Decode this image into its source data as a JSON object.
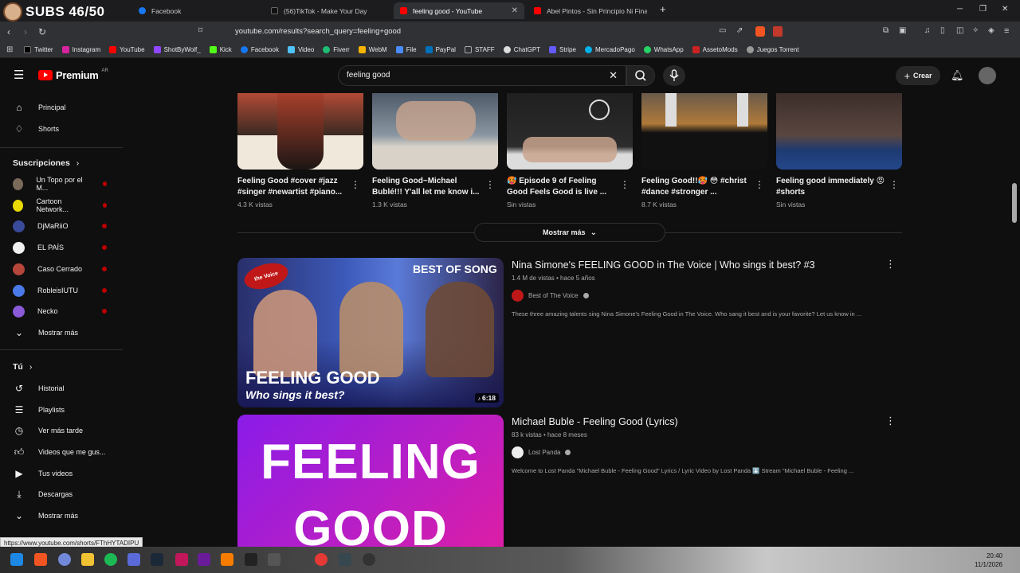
{
  "overlay": {
    "subs": "SUBS 46/50"
  },
  "tabs": [
    {
      "title": "Facebook",
      "color": "#1877f2"
    },
    {
      "title": "(56)TikTok - Make Your Day",
      "color": "#111111"
    },
    {
      "title": "feeling good - YouTube",
      "color": "#ff0000"
    },
    {
      "title": "Abel Pintos - Sin Principio Ni Final (O...",
      "color": "#ff0000"
    }
  ],
  "address": {
    "url": "youtube.com/results?search_query=feeling+good"
  },
  "bookmarks": [
    {
      "label": "Twitter",
      "color": "#000000"
    },
    {
      "label": "Instagram",
      "color": "#d6249f"
    },
    {
      "label": "YouTube",
      "color": "#ff0000"
    },
    {
      "label": "ShotByWolf_",
      "color": "#9146ff"
    },
    {
      "label": "Kick",
      "color": "#53fc18"
    },
    {
      "label": "Facebook",
      "color": "#1877f2"
    },
    {
      "label": "Video",
      "color": "#4fc3f7"
    },
    {
      "label": "Fiverr",
      "color": "#1dbf73"
    },
    {
      "label": "WebM",
      "color": "#f4b400"
    },
    {
      "label": "File",
      "color": "#4a8cff"
    },
    {
      "label": "PayPal",
      "color": "#0070ba"
    },
    {
      "label": "STAFF",
      "color": "#aaaaaa"
    },
    {
      "label": "ChatGPT",
      "color": "#dddddd"
    },
    {
      "label": "Stripe",
      "color": "#635bff"
    },
    {
      "label": "MercadoPago",
      "color": "#00b1ea"
    },
    {
      "label": "WhatsApp",
      "color": "#25d366"
    },
    {
      "label": "AssetoMods",
      "color": "#cc2222"
    },
    {
      "label": "Juegos Torrent",
      "color": "#999999"
    }
  ],
  "youtube": {
    "logo": "Premium",
    "logo_badge": "AR",
    "search_value": "feeling good",
    "create_label": "Crear"
  },
  "sidebar": {
    "main": [
      {
        "label": "Principal",
        "icon": "home-icon"
      },
      {
        "label": "Shorts",
        "icon": "shorts-icon"
      }
    ],
    "subs_header": "Suscripciones",
    "subscriptions": [
      {
        "label": "Un Topo por el M...",
        "color": "#7a6a5a"
      },
      {
        "label": "Cartoon Network...",
        "color": "#e8d900"
      },
      {
        "label": "DjMaRiiO",
        "color": "#3a4a9a"
      },
      {
        "label": "EL PAÍS",
        "color": "#f1f1f1"
      },
      {
        "label": "Caso Cerrado",
        "color": "#b7463a"
      },
      {
        "label": "RobleisIUTU",
        "color": "#4a7ae8"
      },
      {
        "label": "Necko",
        "color": "#8a5ad8"
      }
    ],
    "more_subs": "Mostrar más",
    "you_header": "Tú",
    "you_items": [
      {
        "label": "Historial",
        "icon": "history-icon"
      },
      {
        "label": "Playlists",
        "icon": "playlists-icon"
      },
      {
        "label": "Ver más tarde",
        "icon": "watch-later-icon"
      },
      {
        "label": "Videos que me gus...",
        "icon": "like-icon"
      },
      {
        "label": "Tus videos",
        "icon": "your-videos-icon"
      },
      {
        "label": "Descargas",
        "icon": "downloads-icon"
      }
    ],
    "more_you": "Mostrar más"
  },
  "shorts": [
    {
      "title": "Feeling Good #cover #jazz #singer #newartist #piano...",
      "views": "4.3 K vistas",
      "bg": "#8a3b2a"
    },
    {
      "title": "Feeling Good~Michael Bublé!!! Y'all let me know i...",
      "views": "1.3 K vistas",
      "bg": "#5a6a78"
    },
    {
      "title": "🥵 Episode 9 of Feeling Good Feels Good is live ...",
      "views": "Sin vistas",
      "bg": "#2a2a2a"
    },
    {
      "title": "Feeling Good!!🥵 😳 #christ #dance #stronger ...",
      "views": "8.7 K vistas",
      "bg": "#6a4a2a"
    },
    {
      "title": "Feeling good immediately 😡 #shorts",
      "views": "Sin vistas",
      "bg": "#4a3a3a"
    }
  ],
  "show_more": "Mostrar más",
  "videos": [
    {
      "title": "Nina Simone's FEELING GOOD in The Voice | Who sings it best? #3",
      "meta": "1.4 M de vistas • hace 5 años",
      "channel": "Best of The Voice",
      "desc": "These three amazing talents sing Nina Simone's Feeling Good in The Voice. Who sang it best and is your favorite? Let us know in ...",
      "duration": "6:18",
      "thumb_text1": "FEELING GOOD",
      "thumb_text2": "Who sings it best?",
      "thumb_badge": "BEST OF SONG",
      "thumb_logo": "the Voice"
    },
    {
      "title": "Michael Buble - Feeling Good (Lyrics)",
      "meta": "83 k vistas • hace 8 meses",
      "channel": "Lost Panda",
      "desc": "Welcome to Lost Panda \"Michael Buble - Feeling Good\" Lyrics / Lyric Video by Lost Panda ⬇️ Stream \"Michael Buble - Feeling ...",
      "thumb_line1": "FEELING",
      "thumb_line2": "GOOD"
    }
  ],
  "status_url": "https://www.youtube.com/shorts/FThHYTADIPU",
  "clock": {
    "time": "20:40",
    "date": "11/1/2026"
  }
}
